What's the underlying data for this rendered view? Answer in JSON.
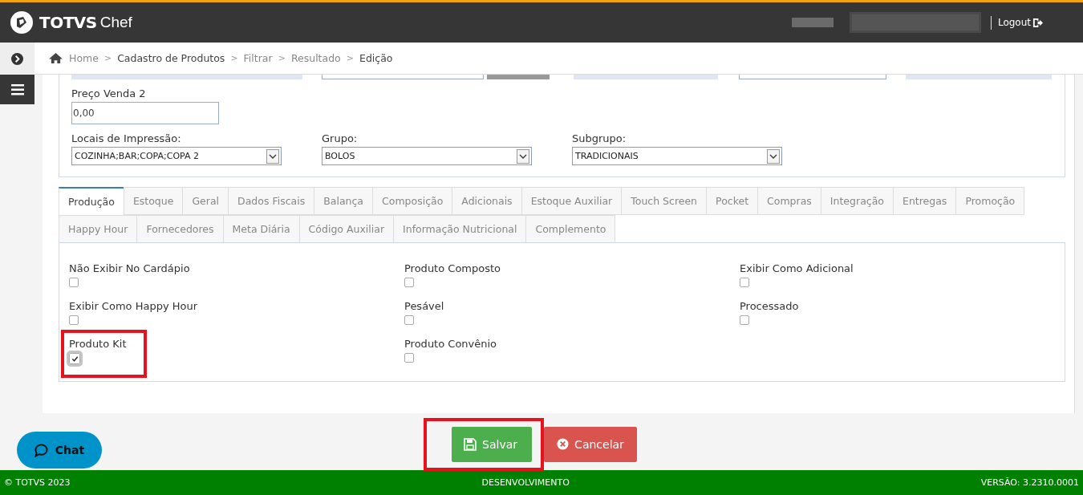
{
  "header": {
    "brand": "TOTVS",
    "brand_suffix": "Chef",
    "logout": "Logout"
  },
  "breadcrumb": [
    {
      "label": "Home",
      "current": false
    },
    {
      "label": "Cadastro de Produtos",
      "current": true
    },
    {
      "label": "Filtrar",
      "current": false
    },
    {
      "label": "Resultado",
      "current": false
    },
    {
      "label": "Edição",
      "current": true
    }
  ],
  "breadcrumb_separator": ">",
  "price_field": {
    "label": "Preço Venda 2",
    "value": "0,00"
  },
  "selects": [
    {
      "label": "Locais de Impressão:",
      "value": "COZINHA;BAR;COPA;COPA 2"
    },
    {
      "label": "Grupo:",
      "value": "BOLOS"
    },
    {
      "label": "Subgrupo:",
      "value": "TRADICIONAIS"
    }
  ],
  "tabs": [
    [
      {
        "label": "Produção",
        "selected": true
      },
      {
        "label": "Estoque",
        "selected": false
      },
      {
        "label": "Geral",
        "selected": false
      },
      {
        "label": "Dados Fiscais",
        "selected": false
      },
      {
        "label": "Balança",
        "selected": false
      },
      {
        "label": "Composição",
        "selected": false
      },
      {
        "label": "Adicionais",
        "selected": false
      },
      {
        "label": "Estoque Auxiliar",
        "selected": false
      },
      {
        "label": "Touch Screen",
        "selected": false
      },
      {
        "label": "Pocket",
        "selected": false
      },
      {
        "label": "Compras",
        "selected": false
      },
      {
        "label": "Integração",
        "selected": false
      },
      {
        "label": "Entregas",
        "selected": false
      },
      {
        "label": "Promoção",
        "selected": false
      }
    ],
    [
      {
        "label": "Happy Hour",
        "selected": false
      },
      {
        "label": "Fornecedores",
        "selected": false
      },
      {
        "label": "Meta Diária",
        "selected": false
      },
      {
        "label": "Código Auxiliar",
        "selected": false
      },
      {
        "label": "Informação Nutricional",
        "selected": false
      },
      {
        "label": "Complemento",
        "selected": false
      }
    ]
  ],
  "options": [
    {
      "label": "Não Exibir No Cardápio",
      "checked": false,
      "highlighted": false
    },
    {
      "label": "Produto Composto",
      "checked": false,
      "highlighted": false
    },
    {
      "label": "Exibir Como Adicional",
      "checked": false,
      "highlighted": false
    },
    {
      "label": "Exibir Como Happy Hour",
      "checked": false,
      "highlighted": false
    },
    {
      "label": "Pesável",
      "checked": false,
      "highlighted": false
    },
    {
      "label": "Processado",
      "checked": false,
      "highlighted": false
    },
    {
      "label": "Produto Kit",
      "checked": true,
      "highlighted": true
    },
    {
      "label": "Produto Convênio",
      "checked": false,
      "highlighted": false
    }
  ],
  "buttons": [
    {
      "kind": "save",
      "label": "Salvar",
      "highlighted": true
    },
    {
      "kind": "cancel",
      "label": "Cancelar",
      "highlighted": false
    }
  ],
  "chat": {
    "label": "Chat"
  },
  "footer": {
    "copyright": "© TOTVS 2023",
    "environment": "DESENVOLVIMENTO",
    "version": "VERSÃO: 3.2310.0001"
  }
}
